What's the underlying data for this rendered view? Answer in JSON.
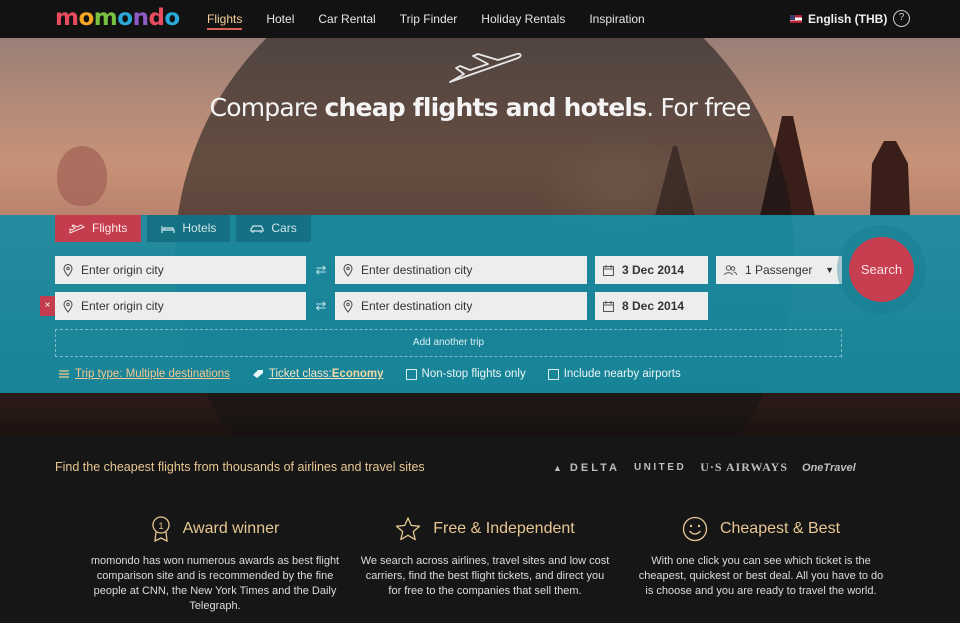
{
  "brand": {
    "logo_letters": [
      "m",
      "o",
      "m",
      "o",
      "n",
      "d",
      "o"
    ]
  },
  "nav": {
    "items": [
      {
        "label": "Flights",
        "active": true
      },
      {
        "label": "Hotel"
      },
      {
        "label": "Car Rental"
      },
      {
        "label": "Trip Finder"
      },
      {
        "label": "Holiday Rentals"
      },
      {
        "label": "Inspiration"
      }
    ],
    "language": "English (THB)",
    "help_icon": "question-icon"
  },
  "hero": {
    "headline_pre": "Compare ",
    "headline_bold": "cheap flights and hotels",
    "headline_post": ". For free"
  },
  "search": {
    "tabs": [
      {
        "label": "Flights",
        "icon": "plane-icon",
        "active": true
      },
      {
        "label": "Hotels",
        "icon": "bed-icon"
      },
      {
        "label": "Cars",
        "icon": "car-icon"
      }
    ],
    "origin_placeholder": "Enter origin city",
    "destination_placeholder": "Enter destination city",
    "trip1_date": "3 Dec 2014",
    "trip2_date": "8 Dec 2014",
    "passengers": "1 Passenger",
    "search_label": "Search",
    "remove_label": "×",
    "add_trip_label": "Add another trip",
    "trip_type": "Trip type: Multiple destinations",
    "ticket_class_label": "Ticket class: ",
    "ticket_class_value": "Economy",
    "nonstop_label": "Non-stop flights only",
    "nearby_label": "Include nearby airports"
  },
  "partners": {
    "tagline": "Find the cheapest flights from thousands of airlines and travel sites",
    "airlines": [
      "DELTA",
      "UNITED",
      "U·S AIRWAYS",
      "OneTravel"
    ]
  },
  "features": [
    {
      "icon": "award-medal-icon",
      "title": "Award winner",
      "body": "momondo has won numerous awards as best flight comparison site and is recommended by the fine people at CNN, the New York Times and the Daily Telegraph."
    },
    {
      "icon": "star-icon",
      "title": "Free & Independent",
      "body": "We search across airlines, travel sites and low cost carriers, find the best flight tickets, and direct you for free to the companies that sell them."
    },
    {
      "icon": "smiley-icon",
      "title": "Cheapest & Best",
      "body": "With one click you can see which ticket is the cheapest, quickest or best deal. All you have to do is choose and you are ready to travel the world."
    }
  ],
  "colors": {
    "accent_red": "#c73e50",
    "search_band": "#188da3",
    "gold_text": "#e8c792"
  }
}
